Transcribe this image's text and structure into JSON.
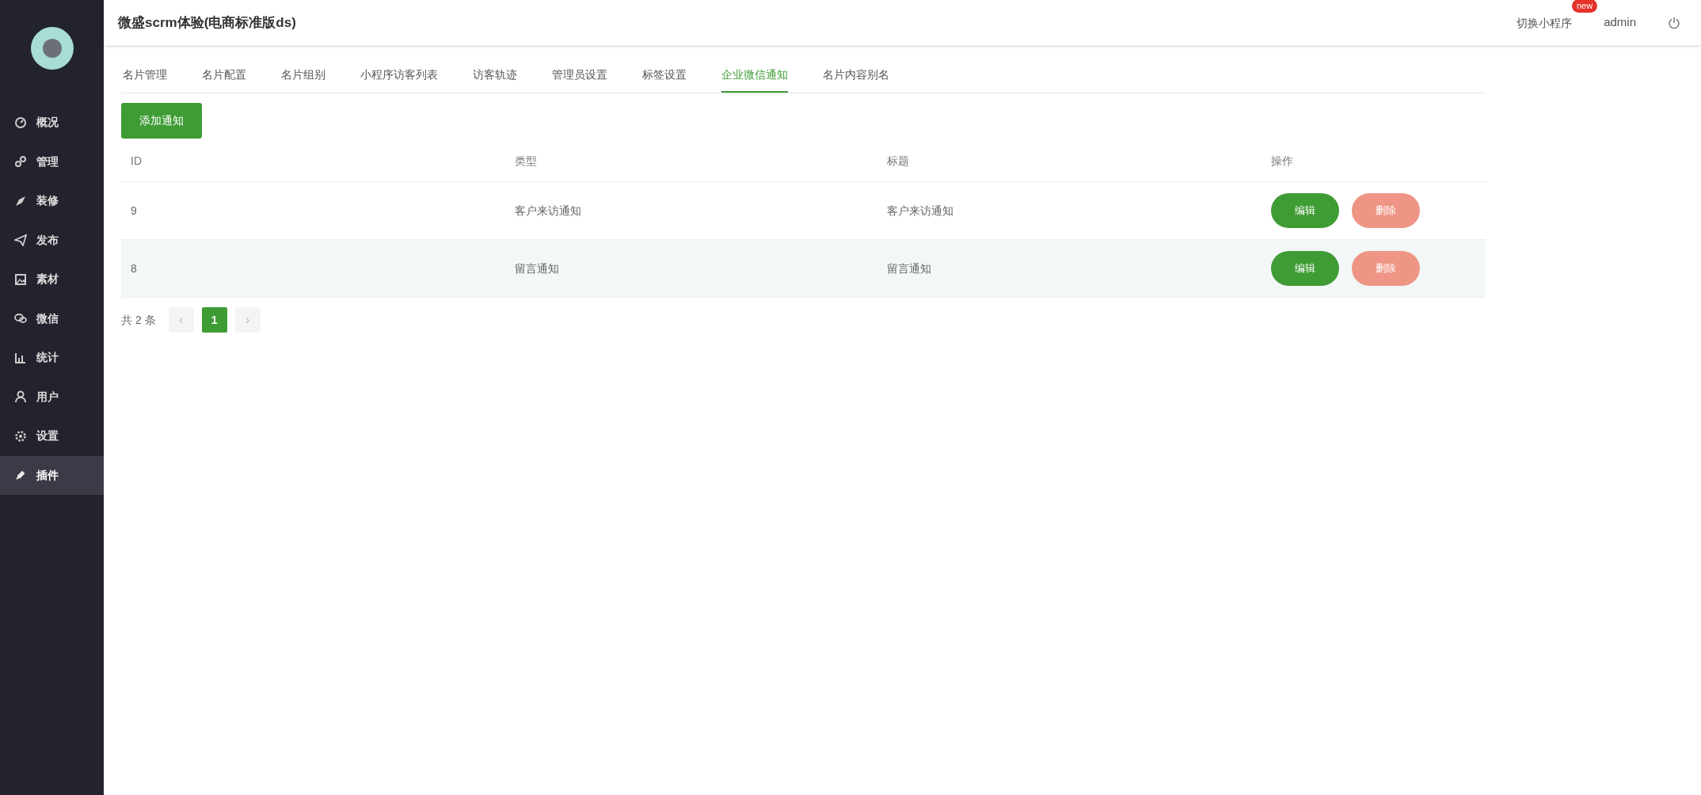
{
  "sidebar": {
    "items": [
      {
        "label": "概况",
        "selected": false
      },
      {
        "label": "管理",
        "selected": false
      },
      {
        "label": "装修",
        "selected": false
      },
      {
        "label": "发布",
        "selected": false
      },
      {
        "label": "素材",
        "selected": false
      },
      {
        "label": "微信",
        "selected": false
      },
      {
        "label": "统计",
        "selected": false
      },
      {
        "label": "用户",
        "selected": false
      },
      {
        "label": "设置",
        "selected": false
      },
      {
        "label": "插件",
        "selected": true
      }
    ]
  },
  "header": {
    "title": "微盛scrm体验(电商标准版ds)",
    "switch_link": "切换小程序",
    "badge": "new",
    "user": "admin"
  },
  "tabs": [
    {
      "label": "名片管理",
      "selected": false
    },
    {
      "label": "名片配置",
      "selected": false
    },
    {
      "label": "名片组别",
      "selected": false
    },
    {
      "label": "小程序访客列表",
      "selected": false
    },
    {
      "label": "访客轨迹",
      "selected": false
    },
    {
      "label": "管理员设置",
      "selected": false
    },
    {
      "label": "标签设置",
      "selected": false
    },
    {
      "label": "企业微信通知",
      "selected": true
    },
    {
      "label": "名片内容别名",
      "selected": false
    }
  ],
  "add_button": "添加通知",
  "table": {
    "columns": [
      "ID",
      "类型",
      "标题",
      "操作"
    ],
    "rows": [
      {
        "id": "9",
        "type": "客户来访通知",
        "title": "客户来访通知",
        "edit": "编辑",
        "delete": "删除",
        "highlighted": false
      },
      {
        "id": "8",
        "type": "留言通知",
        "title": "留言通知",
        "edit": "编辑",
        "delete": "删除",
        "highlighted": true
      }
    ]
  },
  "pagination": {
    "total": "共 2 条",
    "prev": "‹",
    "next": "›",
    "pages": [
      {
        "label": "1",
        "selected": true
      }
    ]
  }
}
